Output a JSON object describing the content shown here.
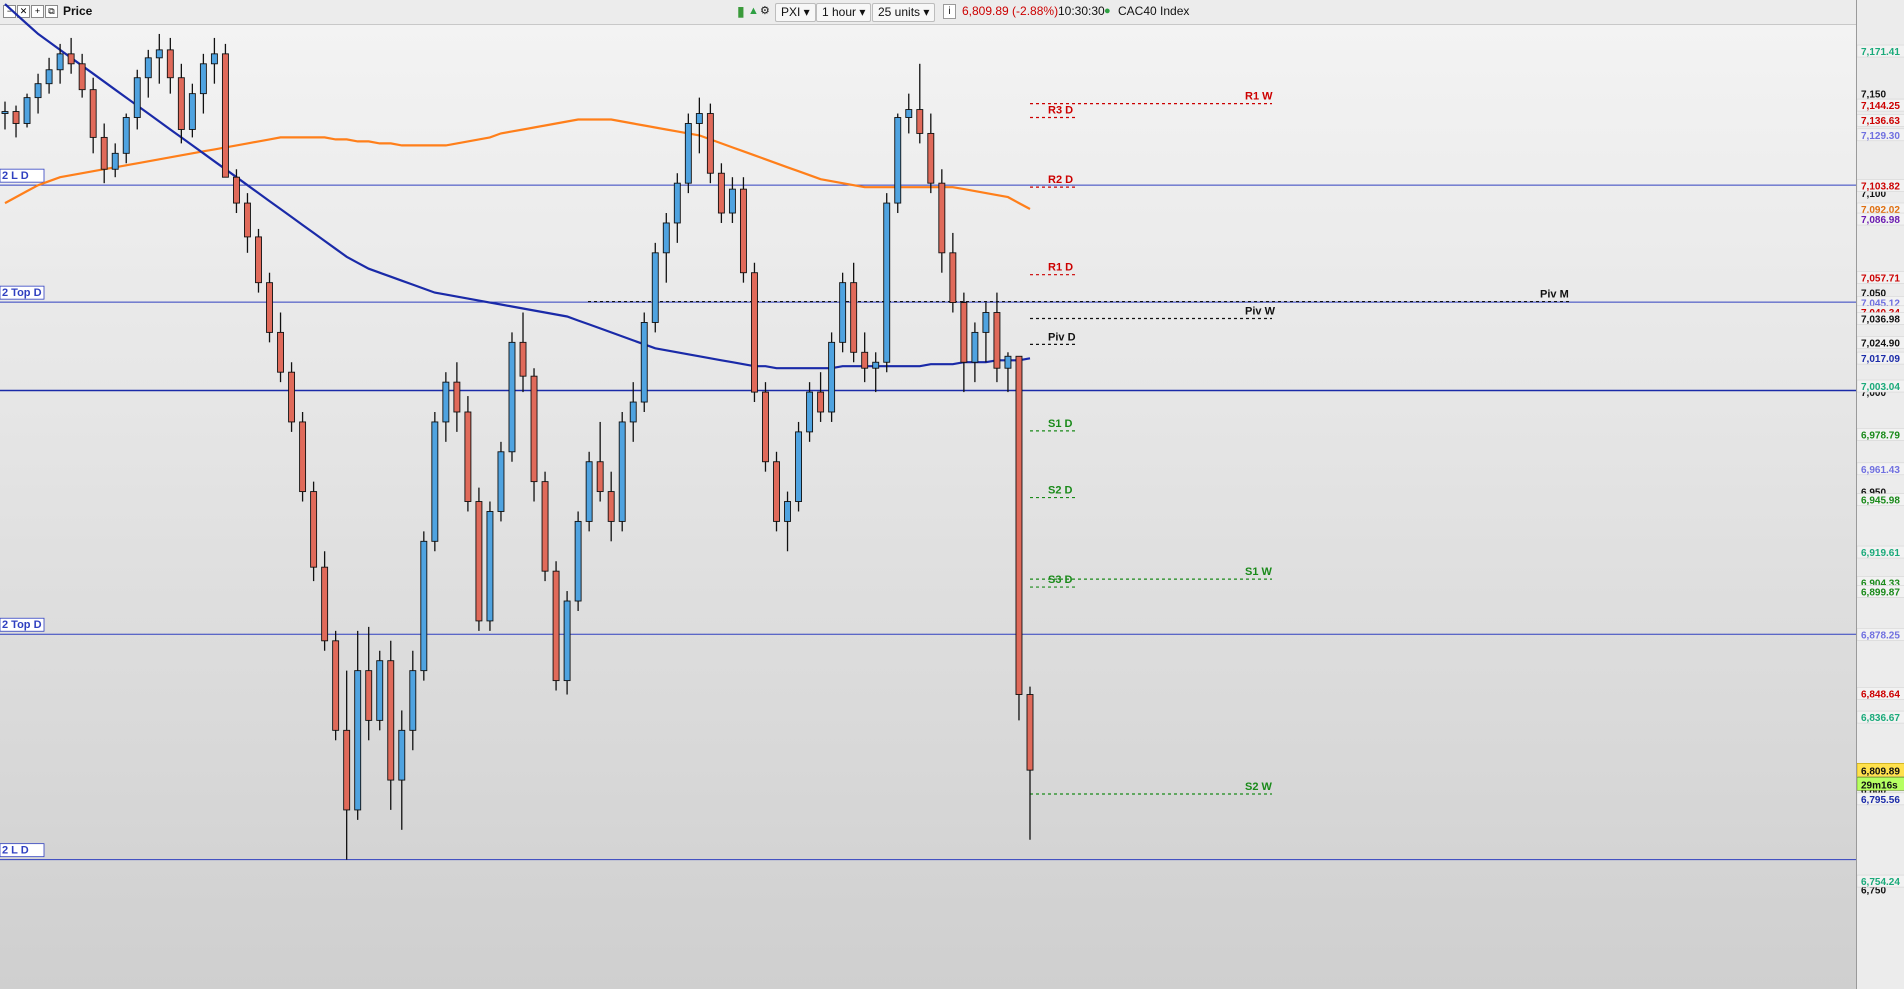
{
  "toolbar": {
    "price_label": "Price",
    "instrument": "PXI",
    "interval": "1 hour",
    "zoom": "25 units",
    "last_quote": "6,809.89 (-2.88%)",
    "time": "10:30:30",
    "index_name": "CAC40 Index",
    "colors": {
      "quote_negative": "#cc0000",
      "status_dot": "#2ea043"
    }
  },
  "chart_data": {
    "type": "candlestick",
    "instrument": "CAC40 Index",
    "interval": "1 hour",
    "ylim": [
      6735,
      7180
    ],
    "axis_ticks": [
      "7,150",
      "7,100",
      "7,050",
      "7,000",
      "6,950",
      "6,900",
      "6,850",
      "6,800",
      "6,750"
    ],
    "price_labels": [
      {
        "text": "7,171.41",
        "value": 7171.41,
        "color": "#1aaa7a"
      },
      {
        "text": "7,144.25",
        "value": 7144.25,
        "color": "#cc0000"
      },
      {
        "text": "7,136.63",
        "value": 7136.63,
        "color": "#cc0000"
      },
      {
        "text": "7,129.30",
        "value": 7129.3,
        "color": "#7070e0"
      },
      {
        "text": "7,103.82",
        "value": 7103.82,
        "color": "#cc0000"
      },
      {
        "text": "7,092.02",
        "value": 7092.02,
        "color": "#e07010"
      },
      {
        "text": "7,086.98",
        "value": 7086.98,
        "color": "#6a1ab0"
      },
      {
        "text": "7,057.71",
        "value": 7057.71,
        "color": "#cc0000"
      },
      {
        "text": "7,045.12",
        "value": 7045.12,
        "color": "#7070e0"
      },
      {
        "text": "7,040.34",
        "value": 7040.34,
        "color": "#cc0000"
      },
      {
        "text": "7,036.98",
        "value": 7036.98,
        "color": "#111111"
      },
      {
        "text": "7,024.90",
        "value": 7024.9,
        "color": "#111111"
      },
      {
        "text": "7,017.09",
        "value": 7017.09,
        "color": "#1a2aa8"
      },
      {
        "text": "7,003.04",
        "value": 7003.04,
        "color": "#1aaa7a"
      },
      {
        "text": "6,978.79",
        "value": 6978.79,
        "color": "#1a8a1a"
      },
      {
        "text": "6,961.43",
        "value": 6961.43,
        "color": "#7070e0"
      },
      {
        "text": "6,945.98",
        "value": 6945.98,
        "color": "#1a8a1a"
      },
      {
        "text": "6,919.61",
        "value": 6919.61,
        "color": "#1aaa7a"
      },
      {
        "text": "6,904.33",
        "value": 6904.33,
        "color": "#1a8a1a"
      },
      {
        "text": "6,899.87",
        "value": 6899.87,
        "color": "#1a8a1a"
      },
      {
        "text": "6,878.25",
        "value": 6878.25,
        "color": "#7070e0"
      },
      {
        "text": "6,848.64",
        "value": 6848.64,
        "color": "#cc0000"
      },
      {
        "text": "6,836.67",
        "value": 6836.67,
        "color": "#1aaa7a"
      },
      {
        "text": "6,795.56",
        "value": 6795.56,
        "color": "#1a2aa8"
      },
      {
        "text": "6,754.24",
        "value": 6754.24,
        "color": "#1aaa7a"
      }
    ],
    "last_price": {
      "text": "6,809.89",
      "value": 6809.89,
      "countdown": "29m16s"
    },
    "pivots": [
      {
        "label": "R1 W",
        "value": 7145.0,
        "color": "#cc0000"
      },
      {
        "label": "R3 D",
        "value": 7138.0,
        "color": "#cc0000"
      },
      {
        "label": "R2 D",
        "value": 7103.0,
        "color": "#cc0000"
      },
      {
        "label": "R1 D",
        "value": 7059.0,
        "color": "#cc0000"
      },
      {
        "label": "Piv M",
        "value": 7045.5,
        "color": "#111111"
      },
      {
        "label": "Piv W",
        "value": 7037.0,
        "color": "#111111"
      },
      {
        "label": "Piv D",
        "value": 7024.0,
        "color": "#111111"
      },
      {
        "label": "S1 D",
        "value": 6980.5,
        "color": "#1a8a1a"
      },
      {
        "label": "S2 D",
        "value": 6947.0,
        "color": "#1a8a1a"
      },
      {
        "label": "S1 W",
        "value": 6906.0,
        "color": "#1a8a1a"
      },
      {
        "label": "S3 D",
        "value": 6902.0,
        "color": "#1a8a1a"
      },
      {
        "label": "S2 W",
        "value": 6798.0,
        "color": "#1a8a1a"
      }
    ],
    "horizontal_lines": [
      {
        "label": "2 L D",
        "value": 7104.0,
        "color": "#3040c0"
      },
      {
        "label": "2 Top D",
        "value": 7045.2,
        "color": "#3040c0"
      },
      {
        "label": "",
        "value": 7000.8,
        "color": "#1a2aa8"
      },
      {
        "label": "2 Top D",
        "value": 6878.3,
        "color": "#3040c0"
      },
      {
        "label": "2 L D",
        "value": 6765.0,
        "color": "#3040c0"
      }
    ],
    "candles": [
      [
        7140,
        7146,
        7132,
        7141
      ],
      [
        7141,
        7144,
        7128,
        7135
      ],
      [
        7135,
        7150,
        7133,
        7148
      ],
      [
        7148,
        7160,
        7140,
        7155
      ],
      [
        7155,
        7168,
        7150,
        7162
      ],
      [
        7162,
        7175,
        7155,
        7170
      ],
      [
        7170,
        7178,
        7160,
        7165
      ],
      [
        7165,
        7170,
        7148,
        7152
      ],
      [
        7152,
        7158,
        7120,
        7128
      ],
      [
        7128,
        7135,
        7105,
        7112
      ],
      [
        7112,
        7125,
        7108,
        7120
      ],
      [
        7120,
        7140,
        7115,
        7138
      ],
      [
        7138,
        7162,
        7132,
        7158
      ],
      [
        7158,
        7172,
        7148,
        7168
      ],
      [
        7168,
        7180,
        7155,
        7172
      ],
      [
        7172,
        7178,
        7150,
        7158
      ],
      [
        7158,
        7165,
        7125,
        7132
      ],
      [
        7132,
        7155,
        7128,
        7150
      ],
      [
        7150,
        7170,
        7140,
        7165
      ],
      [
        7165,
        7178,
        7155,
        7170
      ],
      [
        7170,
        7175,
        7115,
        7108
      ],
      [
        7108,
        7112,
        7090,
        7095
      ],
      [
        7095,
        7100,
        7070,
        7078
      ],
      [
        7078,
        7082,
        7050,
        7055
      ],
      [
        7055,
        7060,
        7025,
        7030
      ],
      [
        7030,
        7040,
        7005,
        7010
      ],
      [
        7010,
        7015,
        6980,
        6985
      ],
      [
        6985,
        6990,
        6945,
        6950
      ],
      [
        6950,
        6955,
        6905,
        6912
      ],
      [
        6912,
        6920,
        6870,
        6875
      ],
      [
        6875,
        6880,
        6825,
        6830
      ],
      [
        6830,
        6860,
        6765,
        6790
      ],
      [
        6790,
        6880,
        6785,
        6860
      ],
      [
        6860,
        6882,
        6825,
        6835
      ],
      [
        6835,
        6870,
        6830,
        6865
      ],
      [
        6865,
        6875,
        6790,
        6805
      ],
      [
        6805,
        6840,
        6780,
        6830
      ],
      [
        6830,
        6870,
        6820,
        6860
      ],
      [
        6860,
        6930,
        6855,
        6925
      ],
      [
        6925,
        6990,
        6920,
        6985
      ],
      [
        6985,
        7010,
        6975,
        7005
      ],
      [
        7005,
        7015,
        6980,
        6990
      ],
      [
        6990,
        6998,
        6940,
        6945
      ],
      [
        6945,
        6952,
        6880,
        6885
      ],
      [
        6885,
        6945,
        6880,
        6940
      ],
      [
        6940,
        6975,
        6935,
        6970
      ],
      [
        6970,
        7030,
        6965,
        7025
      ],
      [
        7025,
        7040,
        7000,
        7008
      ],
      [
        7008,
        7012,
        6945,
        6955
      ],
      [
        6955,
        6960,
        6905,
        6910
      ],
      [
        6910,
        6915,
        6850,
        6855
      ],
      [
        6855,
        6900,
        6848,
        6895
      ],
      [
        6895,
        6940,
        6890,
        6935
      ],
      [
        6935,
        6970,
        6930,
        6965
      ],
      [
        6965,
        6985,
        6945,
        6950
      ],
      [
        6950,
        6960,
        6925,
        6935
      ],
      [
        6935,
        6990,
        6930,
        6985
      ],
      [
        6985,
        7005,
        6975,
        6995
      ],
      [
        6995,
        7040,
        6990,
        7035
      ],
      [
        7035,
        7075,
        7030,
        7070
      ],
      [
        7070,
        7090,
        7055,
        7085
      ],
      [
        7085,
        7110,
        7075,
        7105
      ],
      [
        7105,
        7140,
        7100,
        7135
      ],
      [
        7135,
        7148,
        7120,
        7140
      ],
      [
        7140,
        7145,
        7105,
        7110
      ],
      [
        7110,
        7115,
        7085,
        7090
      ],
      [
        7090,
        7108,
        7085,
        7102
      ],
      [
        7102,
        7108,
        7055,
        7060
      ],
      [
        7060,
        7065,
        6995,
        7000
      ],
      [
        7000,
        7005,
        6960,
        6965
      ],
      [
        6965,
        6970,
        6930,
        6935
      ],
      [
        6935,
        6950,
        6920,
        6945
      ],
      [
        6945,
        6985,
        6940,
        6980
      ],
      [
        6980,
        7005,
        6975,
        7000
      ],
      [
        7000,
        7010,
        6985,
        6990
      ],
      [
        6990,
        7030,
        6985,
        7025
      ],
      [
        7025,
        7060,
        7020,
        7055
      ],
      [
        7055,
        7065,
        7015,
        7020
      ],
      [
        7020,
        7030,
        7005,
        7012
      ],
      [
        7012,
        7020,
        7000,
        7015
      ],
      [
        7015,
        7100,
        7010,
        7095
      ],
      [
        7095,
        7140,
        7090,
        7138
      ],
      [
        7138,
        7150,
        7130,
        7142
      ],
      [
        7142,
        7165,
        7125,
        7130
      ],
      [
        7130,
        7140,
        7100,
        7105
      ],
      [
        7105,
        7112,
        7060,
        7070
      ],
      [
        7070,
        7080,
        7040,
        7045
      ],
      [
        7045,
        7050,
        7000,
        7015
      ],
      [
        7015,
        7035,
        7005,
        7030
      ],
      [
        7030,
        7045,
        7015,
        7040
      ],
      [
        7040,
        7050,
        7005,
        7012
      ],
      [
        7012,
        7020,
        7000,
        7018
      ],
      [
        7018,
        7018,
        6835,
        6848
      ],
      [
        6848,
        6852,
        6775,
        6810
      ]
    ],
    "moving_averages": [
      {
        "color": "#ff7f1a",
        "values": [
          7095,
          7098,
          7101,
          7104,
          7106,
          7108,
          7109,
          7110,
          7111,
          7112,
          7113,
          7114,
          7115,
          7116,
          7117,
          7118,
          7119,
          7120,
          7121,
          7122,
          7123,
          7124,
          7125,
          7126,
          7127,
          7128,
          7128,
          7128,
          7128,
          7128,
          7127,
          7127,
          7126,
          7126,
          7125,
          7125,
          7124,
          7124,
          7124,
          7124,
          7124,
          7125,
          7126,
          7127,
          7128,
          7130,
          7131,
          7132,
          7133,
          7134,
          7135,
          7136,
          7137,
          7137,
          7137,
          7137,
          7136,
          7135,
          7134,
          7133,
          7132,
          7131,
          7130,
          7129,
          7127,
          7125,
          7123,
          7121,
          7119,
          7117,
          7115,
          7113,
          7111,
          7109,
          7107,
          7106,
          7105,
          7104,
          7103,
          7103,
          7103,
          7103,
          7103,
          7103,
          7103,
          7103,
          7103,
          7102,
          7101,
          7100,
          7099,
          7098,
          7095,
          7092
        ]
      },
      {
        "color": "#1a2aa8",
        "values": [
          7195,
          7190,
          7185,
          7180,
          7176,
          7172,
          7168,
          7164,
          7160,
          7156,
          7152,
          7148,
          7144,
          7140,
          7136,
          7132,
          7128,
          7124,
          7120,
          7116,
          7112,
          7108,
          7104,
          7100,
          7096,
          7092,
          7088,
          7084,
          7080,
          7076,
          7072,
          7068,
          7065,
          7062,
          7060,
          7058,
          7056,
          7054,
          7052,
          7050,
          7049,
          7048,
          7047,
          7046,
          7045,
          7044,
          7043,
          7042,
          7041,
          7040,
          7039,
          7038,
          7036,
          7034,
          7032,
          7030,
          7028,
          7026,
          7024,
          7022,
          7021,
          7020,
          7019,
          7018,
          7017,
          7016,
          7015,
          7014,
          7013,
          7013,
          7012,
          7012,
          7012,
          7012,
          7012,
          7012,
          7013,
          7013,
          7013,
          7013,
          7013,
          7013,
          7013,
          7013,
          7014,
          7014,
          7014,
          7015,
          7015,
          7015,
          7016,
          7016,
          7016,
          7017
        ]
      }
    ]
  }
}
